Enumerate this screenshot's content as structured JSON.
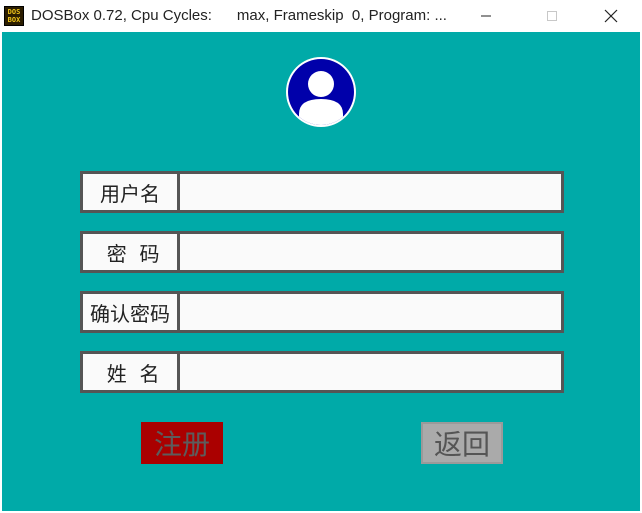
{
  "window": {
    "title": "DOSBox 0.72, Cpu Cycles:      max, Frameskip  0, Program: ...",
    "icon_text": "DOS\nBOX",
    "icons": {
      "app": "dosbox-icon",
      "minimize": "minimize-icon",
      "maximize": "maximize-icon",
      "close": "close-icon"
    }
  },
  "form": {
    "avatar_icon": "user-avatar-icon",
    "fields": [
      {
        "label": "用户名",
        "value": ""
      },
      {
        "label": " 密  码",
        "value": ""
      },
      {
        "label": "确认密码",
        "value": ""
      },
      {
        "label": " 姓  名",
        "value": ""
      }
    ],
    "register_label": "注册",
    "back_label": "返回"
  },
  "colors": {
    "background": "#00aaa8",
    "field_border": "#555555",
    "register_bg": "#aa0000",
    "back_bg": "#aaaaaa",
    "avatar_blue": "#0000aa"
  }
}
